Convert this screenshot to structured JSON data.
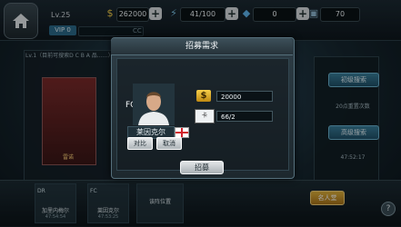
{
  "topbar": {
    "level": "Lv.25",
    "vip": "VIP 0",
    "coins": "262000",
    "energy": "41/100",
    "gems": "0",
    "other": "70",
    "cc_label": "CC"
  },
  "background": {
    "ticker": "Lv.1（目前可搜索D C B A 品……）",
    "card_name": "雷诺",
    "side_btn1": "初级搜索",
    "side_text1": "20点重置次数",
    "side_btn2": "高级搜索",
    "side_time": "47:52:17",
    "right_hint": "0 0",
    "recruit_label": "名人堂",
    "slots": [
      {
        "pos": "DR",
        "name": "加里内梅尔",
        "time": "47:54:54"
      },
      {
        "pos": "FC",
        "name": "莱因克尔",
        "time": "47:53:25"
      },
      {
        "pos": "",
        "name": "该阵位置",
        "time": ""
      }
    ],
    "help": "?"
  },
  "dialog": {
    "title": "招募需求",
    "position": "FC",
    "player_name": "莱因克尔",
    "compare_btn": "对比",
    "cancel_btn": "取消",
    "coin_symbol": "$",
    "coin_value": "20000",
    "card_count": "66/2",
    "card_icon_label": "卡",
    "recruit_btn": "招募"
  },
  "colors": {
    "accent": "#3a7f9b",
    "gold": "#f6cf4a",
    "recruit": "#e0b13b"
  }
}
